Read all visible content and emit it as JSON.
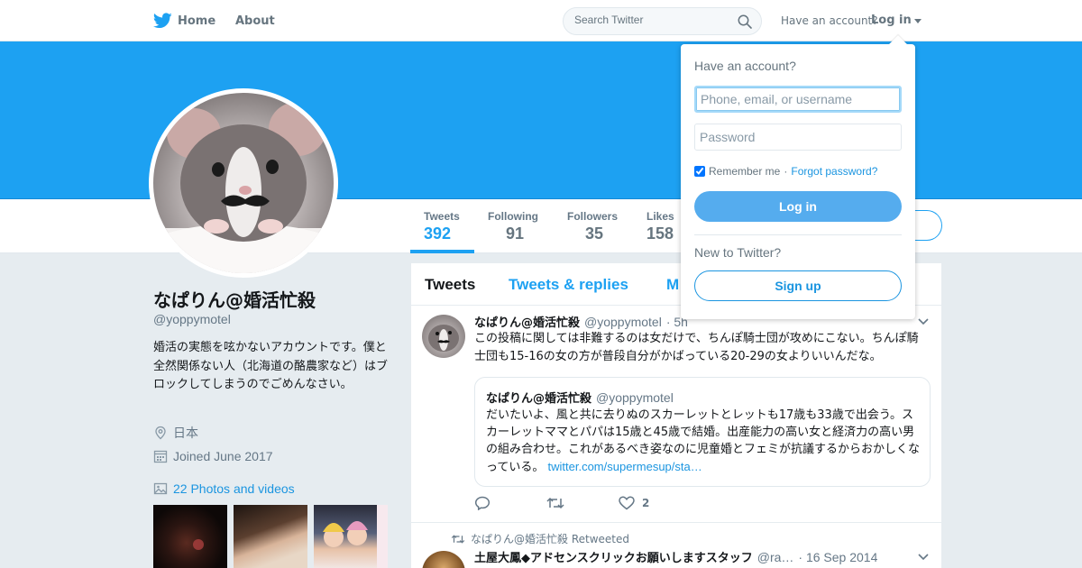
{
  "nav": {
    "home_label": "Home",
    "about_label": "About",
    "search_placeholder": "Search Twitter",
    "have_account": "Have an account?",
    "login_label": "Log in",
    "icons": {
      "logo": "twitter-bird-icon",
      "search": "search-icon",
      "caret": "caret-down-icon"
    }
  },
  "colors": {
    "brand": "#1da1f2",
    "link": "#1b95e0",
    "muted": "#657786",
    "login_button": "#55acee"
  },
  "profile": {
    "name": "なぱりん@婚活忙殺",
    "handle": "@yoppymotel",
    "bio": "婚活の実態を呟かないアカウントです。僕と全然関係ない人（北海道の酪農家など）はブロックしてしまうのでごめんなさい。",
    "location": "日本",
    "joined": "Joined June 2017",
    "photos_link": "22 Photos and videos"
  },
  "stats": [
    {
      "label": "Tweets",
      "value": "392"
    },
    {
      "label": "Following",
      "value": "91"
    },
    {
      "label": "Followers",
      "value": "35"
    },
    {
      "label": "Likes",
      "value": "158"
    }
  ],
  "timeline_tabs": [
    "Tweets",
    "Tweets & replies",
    "M"
  ],
  "tweets": [
    {
      "fullname": "なぱりん@婚活忙殺",
      "username": "@yoppymotel",
      "time": "· 5h",
      "text": "この投稿に関しては非難するのは女だけで、ちんぽ騎士団が攻めにこない。ちんぽ騎士団も15-16の女の方が普段自分がかばっている20-29の女よりいいんだな。",
      "quote": {
        "fullname": "なぱりん@婚活忙殺",
        "username": "@yoppymotel",
        "text": "だいたいよ、風と共に去りぬのスカーレットとレットも17歳も33歳で出会う。スカーレットママとパパは15歳と45歳で結婚。出産能力の高い女と経済力の高い男の組み合わせ。これがあるべき姿なのに児童婚とフェミが抗議するからおかしくなっている。",
        "link": "twitter.com/supermesup/sta…"
      },
      "likes": "2"
    },
    {
      "retweeted_by": "なぱりん@婚活忙殺 Retweeted",
      "fullname": "土屋大鳳◆アドセンスクリックお願いしますスタッフ",
      "username": "@ra…",
      "time": "· 16 Sep 2014"
    }
  ],
  "login_dropdown": {
    "title": "Have an account?",
    "username_placeholder": "Phone, email, or username",
    "password_placeholder": "Password",
    "remember_me": "Remember me",
    "separator": "·",
    "forgot_password": "Forgot password?",
    "login_button": "Log in",
    "new_to_twitter": "New to Twitter?",
    "signup_button": "Sign up"
  }
}
